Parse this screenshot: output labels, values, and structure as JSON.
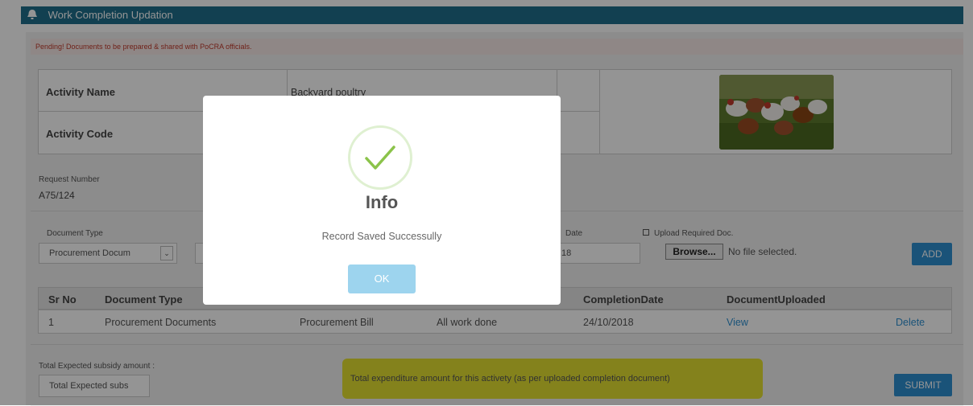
{
  "header": {
    "title": "Work Completion Updation"
  },
  "alert": {
    "text": "Pending! Documents to be prepared & shared with PoCRA officials."
  },
  "activity": {
    "name_label": "Activity Name",
    "name_value": "Backyard poultry",
    "code_label": "Activity Code"
  },
  "request": {
    "label": "Request Number",
    "value": "A75/124"
  },
  "document_form": {
    "doc_type_label": "Document Type",
    "doc_type_value": "Procurement Docum",
    "date_label": "Date",
    "date_value": "18",
    "upload_label": "Upload Required Doc.",
    "browse_label": "Browse...",
    "file_status": "No file selected.",
    "add_label": "ADD"
  },
  "grid": {
    "headers": [
      "Sr No",
      "Document Type",
      "CompletionDate",
      "DocumentUploaded"
    ],
    "rows": [
      {
        "sr": "1",
        "doc_type": "Procurement Documents",
        "doc_name": "Procurement Bill",
        "remark": "All work done",
        "date": "24/10/2018",
        "view": "View",
        "delete": "Delete"
      }
    ]
  },
  "footer": {
    "subsidy_label": "Total Expected subsidy amount :",
    "subsidy_placeholder": "Total Expected subs",
    "expenditure_text": "Total expenditure amount for this activety (as per uploaded completion document)",
    "submit_label": "SUBMIT"
  },
  "modal": {
    "title": "Info",
    "message": "Record Saved Successully",
    "ok_label": "OK"
  },
  "colors": {
    "header_bg": "#1f6e8c",
    "accent": "#2e8fd0",
    "alert_text": "#c0392b",
    "highlight": "#e2e021",
    "success": "#8bc34a"
  }
}
